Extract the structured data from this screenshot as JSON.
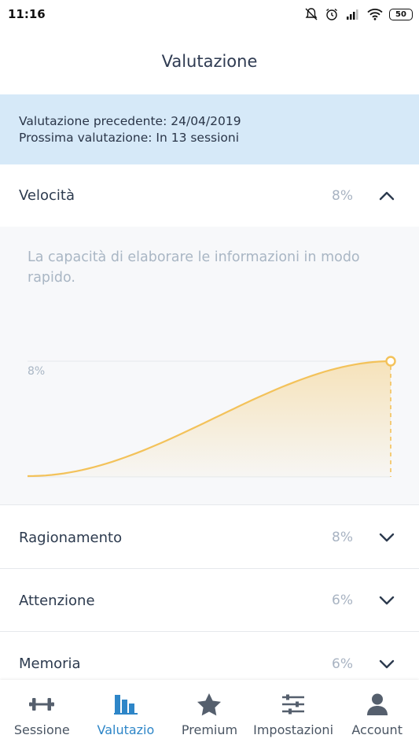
{
  "status_bar": {
    "time": "11:16",
    "battery": "50"
  },
  "header": {
    "title": "Valutazione"
  },
  "banner": {
    "previous": "Valutazione precedente: 24/04/2019",
    "next": "Prossima valutazione: In 13 sessioni"
  },
  "sections": [
    {
      "name": "Velocità",
      "value": "8%",
      "expanded": true,
      "description": "La capacità di elaborare le informazioni in modo rapido."
    },
    {
      "name": "Ragionamento",
      "value": "8%"
    },
    {
      "name": "Attenzione",
      "value": "6%"
    },
    {
      "name": "Memoria",
      "value": "6%"
    }
  ],
  "chart_data": {
    "type": "area",
    "y_label_marker": "8%",
    "end_value_percent": 8,
    "color": "#f3c25a"
  },
  "nav": {
    "items": [
      {
        "label": "Sessione",
        "icon": "dumbbell-icon"
      },
      {
        "label": "Valutazio",
        "icon": "bar-chart-icon",
        "active": true
      },
      {
        "label": "Premium",
        "icon": "star-icon"
      },
      {
        "label": "Impostazioni",
        "icon": "sliders-icon"
      },
      {
        "label": "Account",
        "icon": "user-icon"
      }
    ],
    "active_color": "#2e86c8",
    "inactive_color": "#555f6d"
  }
}
